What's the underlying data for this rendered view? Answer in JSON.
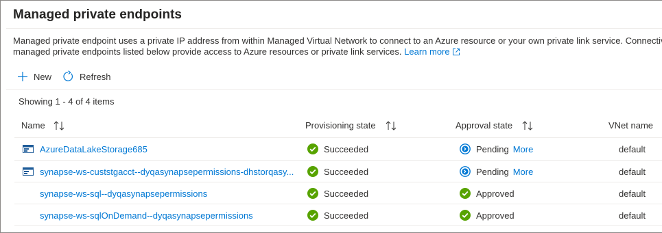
{
  "page": {
    "title": "Managed private endpoints",
    "description_line1": "Managed private endpoint uses a private IP address from within Managed Virtual Network to connect to an Azure resource or your own private link service. Connectivity",
    "description_line2": "managed private endpoints listed below provide access to Azure resources or private link services.",
    "learn_more": "Learn more"
  },
  "toolbar": {
    "new_label": "New",
    "refresh_label": "Refresh"
  },
  "status_text": "Showing 1 - 4 of 4 items",
  "columns": {
    "name": "Name",
    "provisioning": "Provisioning state",
    "approval": "Approval state",
    "vnet": "VNet name"
  },
  "rows": [
    {
      "name": "AzureDataLakeStorage685",
      "has_icon": true,
      "provisioning": "Succeeded",
      "approval": "Pending",
      "approval_more": "More",
      "vnet": "default"
    },
    {
      "name": "synapse-ws-custstgacct--dyqasynapsepermissions-dhstorqasy...",
      "has_icon": true,
      "provisioning": "Succeeded",
      "approval": "Pending",
      "approval_more": "More",
      "vnet": "default"
    },
    {
      "name": "synapse-ws-sql--dyqasynapsepermissions",
      "has_icon": false,
      "provisioning": "Succeeded",
      "approval": "Approved",
      "approval_more": "",
      "vnet": "default"
    },
    {
      "name": "synapse-ws-sqlOnDemand--dyqasynapsepermissions",
      "has_icon": false,
      "provisioning": "Succeeded",
      "approval": "Approved",
      "approval_more": "",
      "vnet": "default"
    }
  ],
  "colors": {
    "accent": "#0078d4",
    "success": "#57a300",
    "pending": "#0078d4"
  }
}
